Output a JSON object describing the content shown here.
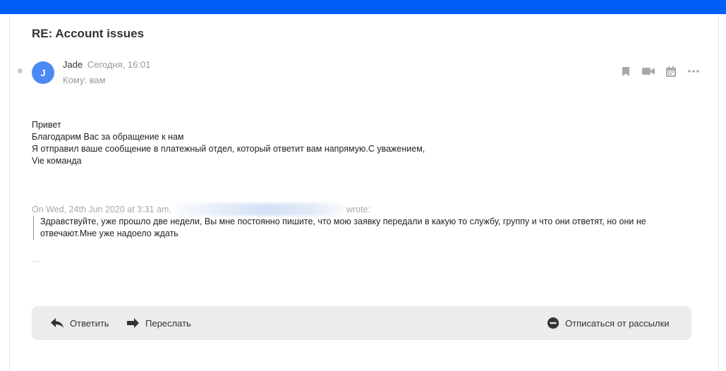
{
  "email": {
    "subject": "RE: Account issues",
    "sender_initial": "J",
    "sender_name": "Jade",
    "date": "Сегодня, 16:01",
    "to_label": "Кому: вам",
    "body_lines": [
      "Привет",
      "Благодарим Вас за обращение к нам",
      "Я отправил ваше сообщение в платежный отдел, который ответит вам напрямую.С уважением,",
      "Vie команда"
    ],
    "quote_prefix": "On Wed, 24th Jun 2020 at 3:31 am,",
    "quote_suffix": "wrote:",
    "quote_lines": [
      "Здравствуйте, уже прошло две недели, Вы мне постоянно пишите, что мою заявку передали в какую то службу, группу и что они ответят, но они не",
      "отвечают.Мне уже надоело ждать"
    ]
  },
  "reply_bar": {
    "reply_label": "Ответить",
    "forward_label": "Переслать",
    "unsubscribe_label": "Отписаться от рассылки"
  },
  "icons": {
    "bookmark": "bookmark-icon",
    "video": "video-camera-icon",
    "calendar": "calendar-icon",
    "more": "more-horizontal-icon",
    "reply": "reply-arrow-icon",
    "forward": "forward-arrow-icon",
    "unsubscribe": "minus-circle-icon"
  },
  "colors": {
    "topbar": "#005ff9",
    "avatar": "#4a8af4",
    "reply_bar_bg": "#ebecee",
    "muted_text": "#999999"
  }
}
